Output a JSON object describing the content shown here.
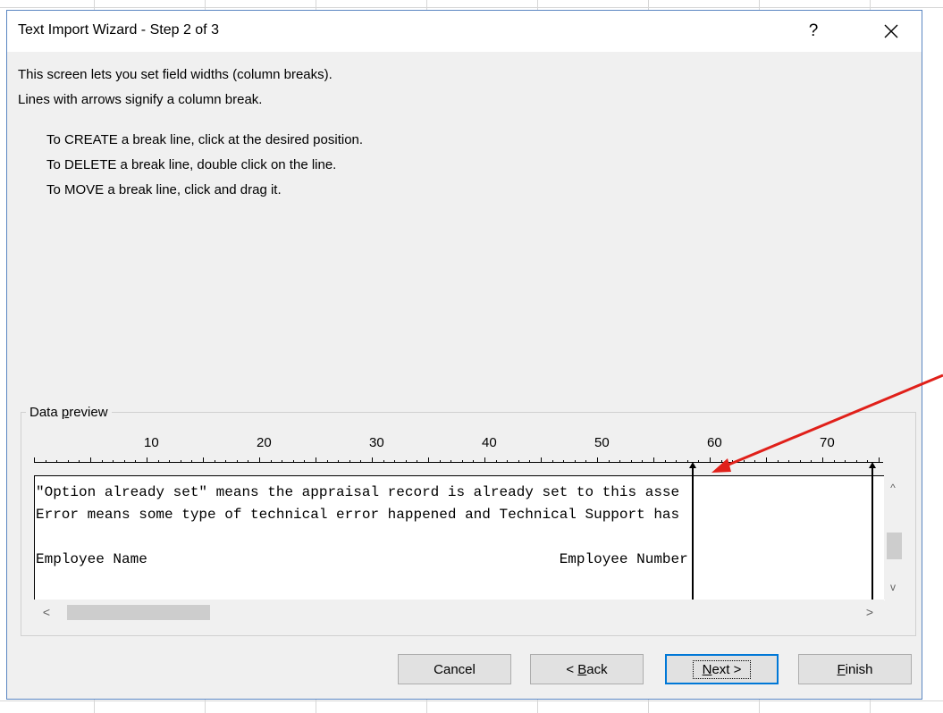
{
  "window": {
    "title": "Text Import Wizard - Step 2 of 3",
    "help_label": "?",
    "close_label": "✕"
  },
  "description": {
    "line1": "This screen lets you set field widths (column breaks).",
    "line2": "Lines with arrows signify a column break."
  },
  "instructions": [
    "To CREATE a break line, click at the desired position.",
    "To DELETE a break line, double click on the line.",
    "To MOVE a break line, click and drag it."
  ],
  "preview": {
    "label_pre": "Data ",
    "label_accel": "p",
    "label_post": "review",
    "ruler_numbers": [
      "10",
      "20",
      "30",
      "40",
      "50",
      "60",
      "70"
    ],
    "rows": [
      "\"Option already set\" means the appraisal record is already set to this asse",
      "Error means some type of technical error happened and Technical Support has",
      "",
      "Employee Name                                                Employee Number"
    ],
    "column_breaks": [
      58,
      74
    ]
  },
  "scrollbars": {
    "up": "^",
    "down": "v",
    "left": "<",
    "right": ">"
  },
  "buttons": {
    "cancel": "Cancel",
    "back_pre": "< ",
    "back_accel": "B",
    "back_post": "ack",
    "next_accel": "N",
    "next_post": "ext >",
    "finish_accel": "F",
    "finish_post": "inish"
  },
  "colors": {
    "annotation_arrow": "#e0201a",
    "default_button_border": "#0078d7"
  }
}
